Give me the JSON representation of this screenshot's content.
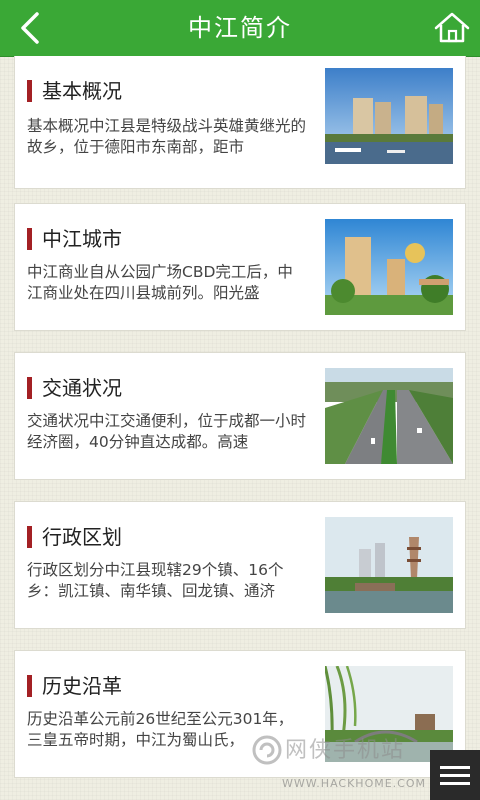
{
  "header": {
    "title": "中江简介",
    "back_icon": "back-icon",
    "home_icon": "home-icon"
  },
  "colors": {
    "header_bg": "#3aa836",
    "accent_bar": "#a32024",
    "page_bg": "#efeee2"
  },
  "items": [
    {
      "title": "基本概况",
      "desc": "基本概况中江县是特级战斗英雄黄继光的故乡，位于德阳市东南部，距市"
    },
    {
      "title": "中江城市",
      "desc": "中江商业自从公园广场CBD完工后，中江商业处在四川县城前列。阳光盛"
    },
    {
      "title": "交通状况",
      "desc": "交通状况中江交通便利，位于成都一小时经济圈，40分钟直达成都。高速"
    },
    {
      "title": "行政区划",
      "desc": "行政区划分中江县现辖29个镇、16个乡：凯江镇、南华镇、回龙镇、通济"
    },
    {
      "title": "历史沿革",
      "desc": "历史沿革公元前26世纪至公元301年，三皇五帝时期，中江为蜀山氏，"
    }
  ],
  "watermark": {
    "text": "网侠手机站",
    "url": "WWW.HACKHOME.COM"
  },
  "menu_icon": "menu-icon"
}
